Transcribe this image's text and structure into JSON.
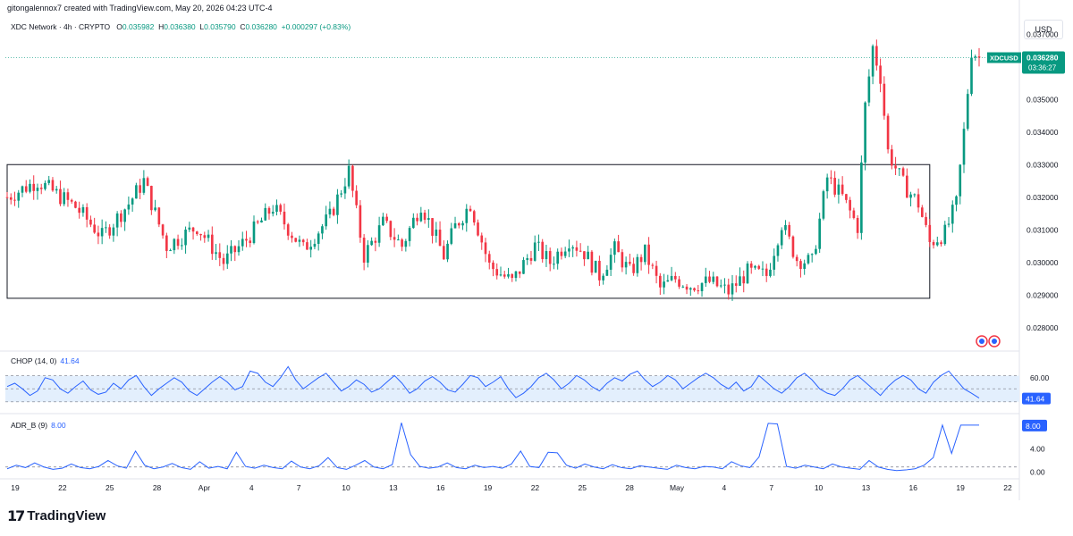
{
  "header": {
    "attribution": "gitongalennox7 created with TradingView.com, May 20, 2026 04:23 UTC-4",
    "symbol_line": "XDC Network · 4h · CRYPTO",
    "o_label": "O",
    "o_value": "0.035982",
    "h_label": "H",
    "h_value": "0.036380",
    "l_label": "L",
    "l_value": "0.035790",
    "c_label": "C",
    "c_value": "0.036280",
    "change": "+0.000297 (+0.83%)"
  },
  "currency_button": "USD",
  "price_tag": {
    "symbol": "XDCUSD",
    "price": "0.036280",
    "countdown": "03:36:27"
  },
  "indicators": {
    "chop": {
      "name": "CHOP (14, 0)",
      "value": "41.64",
      "axis": [
        "60.00"
      ]
    },
    "adr": {
      "name": "ADR_B (9)",
      "value": "8.00",
      "axis": [
        "4.00",
        "0.00"
      ]
    }
  },
  "brand": "TradingView",
  "colors": {
    "up": "#089981",
    "down": "#f23645",
    "indicator": "#2962ff",
    "band_fill": "#e3effd"
  },
  "chart_data": [
    {
      "type": "candlestick",
      "title": "XDC Network · 4h · CRYPTO",
      "y_axis_labels": [
        "0.037000",
        "0.036000",
        "0.035000",
        "0.034000",
        "0.033000",
        "0.032000",
        "0.031000",
        "0.030000",
        "0.029000",
        "0.028000"
      ],
      "ylim": [
        0.0275,
        0.0375
      ],
      "x_tick_labels": [
        "19",
        "22",
        "25",
        "28",
        "Apr",
        "4",
        "7",
        "10",
        "13",
        "16",
        "19",
        "22",
        "25",
        "28",
        "May",
        "4",
        "7",
        "10",
        "13",
        "16",
        "19",
        "22"
      ],
      "close_path": [
        [
          0,
          0.032
        ],
        [
          8,
          0.0325
        ],
        [
          18,
          0.0317
        ],
        [
          25,
          0.0308
        ],
        [
          32,
          0.0318
        ],
        [
          36,
          0.0325
        ],
        [
          42,
          0.0305
        ],
        [
          50,
          0.0311
        ],
        [
          57,
          0.03
        ],
        [
          63,
          0.0307
        ],
        [
          70,
          0.0317
        ],
        [
          78,
          0.0304
        ],
        [
          85,
          0.0314
        ],
        [
          90,
          0.0328
        ],
        [
          94,
          0.0302
        ],
        [
          99,
          0.0312
        ],
        [
          104,
          0.0305
        ],
        [
          109,
          0.0318
        ],
        [
          115,
          0.0302
        ],
        [
          118,
          0.0311
        ],
        [
          122,
          0.0318
        ],
        [
          127,
          0.0299
        ],
        [
          133,
          0.0294
        ],
        [
          139,
          0.0305
        ],
        [
          143,
          0.03
        ],
        [
          148,
          0.0307
        ],
        [
          152,
          0.0303
        ],
        [
          156,
          0.0296
        ],
        [
          160,
          0.0304
        ],
        [
          164,
          0.0297
        ],
        [
          168,
          0.0303
        ],
        [
          172,
          0.0292
        ],
        [
          176,
          0.0295
        ],
        [
          180,
          0.0293
        ],
        [
          185,
          0.0294
        ],
        [
          190,
          0.0291
        ],
        [
          195,
          0.0297
        ],
        [
          200,
          0.0296
        ],
        [
          204,
          0.0312
        ],
        [
          208,
          0.0301
        ],
        [
          212,
          0.03
        ],
        [
          216,
          0.0326
        ],
        [
          220,
          0.032
        ],
        [
          224,
          0.0311
        ],
        [
          226,
          0.0348
        ],
        [
          228,
          0.0366
        ],
        [
          230,
          0.0357
        ],
        [
          232,
          0.0334
        ],
        [
          236,
          0.0324
        ],
        [
          240,
          0.0318
        ],
        [
          243,
          0.0306
        ],
        [
          247,
          0.0309
        ],
        [
          250,
          0.0318
        ],
        [
          252,
          0.034
        ],
        [
          254,
          0.0365
        ],
        [
          256,
          0.0363
        ]
      ],
      "box": {
        "x_start": 0,
        "x_end": 243,
        "top": 0.033,
        "bottom": 0.0289
      },
      "last_price": 0.03628
    },
    {
      "type": "line",
      "series": [
        {
          "name": "CHOP (14, 0)",
          "last": 41.64
        }
      ],
      "band": [
        38.2,
        61.8
      ],
      "ylim": [
        30,
        80
      ],
      "values": [
        52,
        55,
        50,
        44,
        48,
        60,
        58,
        50,
        46,
        52,
        57,
        49,
        45,
        47,
        55,
        50,
        58,
        62,
        52,
        44,
        50,
        55,
        60,
        56,
        48,
        44,
        50,
        56,
        61,
        56,
        49,
        52,
        66,
        64,
        56,
        52,
        60,
        70,
        58,
        50,
        55,
        60,
        64,
        56,
        48,
        52,
        58,
        54,
        47,
        50,
        56,
        62,
        55,
        46,
        50,
        57,
        61,
        56,
        49,
        47,
        54,
        62,
        60,
        52,
        56,
        61,
        50,
        42,
        46,
        52,
        60,
        64,
        58,
        50,
        55,
        62,
        58,
        52,
        48,
        55,
        60,
        57,
        63,
        66,
        58,
        52,
        56,
        62,
        58,
        50,
        55,
        60,
        64,
        60,
        54,
        50,
        56,
        48,
        52,
        62,
        56,
        50,
        46,
        52,
        60,
        64,
        58,
        50,
        46,
        44,
        50,
        58,
        62,
        56,
        50,
        44,
        52,
        58,
        62,
        58,
        50,
        46,
        56,
        62,
        66,
        58,
        50,
        46,
        41.64
      ]
    },
    {
      "type": "line",
      "series": [
        {
          "name": "ADR_B (9)",
          "last": 8.0
        }
      ],
      "ylim": [
        -0.5,
        9.5
      ],
      "values": [
        0.6,
        1.2,
        0.8,
        1.6,
        0.9,
        0.5,
        0.7,
        1.4,
        0.8,
        0.6,
        1.0,
        2.0,
        1.1,
        0.7,
        3.6,
        1.2,
        0.6,
        0.9,
        1.5,
        0.8,
        0.5,
        1.8,
        0.7,
        1.0,
        0.6,
        3.4,
        1.0,
        0.7,
        1.2,
        0.8,
        0.6,
        1.9,
        0.9,
        0.6,
        1.1,
        2.5,
        0.8,
        0.5,
        1.2,
        2.0,
        0.9,
        0.6,
        1.3,
        8.4,
        3.0,
        1.0,
        0.7,
        0.9,
        1.6,
        0.8,
        0.6,
        1.2,
        0.8,
        1.0,
        0.7,
        1.4,
        3.6,
        1.0,
        0.8,
        3.4,
        3.3,
        1.2,
        0.7,
        1.4,
        0.9,
        0.6,
        1.3,
        0.8,
        0.6,
        1.1,
        0.9,
        0.7,
        0.5,
        1.2,
        0.8,
        0.6,
        1.0,
        0.9,
        0.6,
        1.8,
        1.1,
        0.8,
        2.6,
        8.3,
        8.2,
        1.0,
        0.7,
        1.2,
        0.9,
        0.6,
        1.4,
        0.9,
        0.7,
        0.5,
        2.0,
        0.9,
        0.5,
        0.3,
        0.4,
        0.6,
        1.2,
        2.5,
        8.0,
        3.2,
        8.0,
        8.0,
        8.0
      ]
    }
  ]
}
